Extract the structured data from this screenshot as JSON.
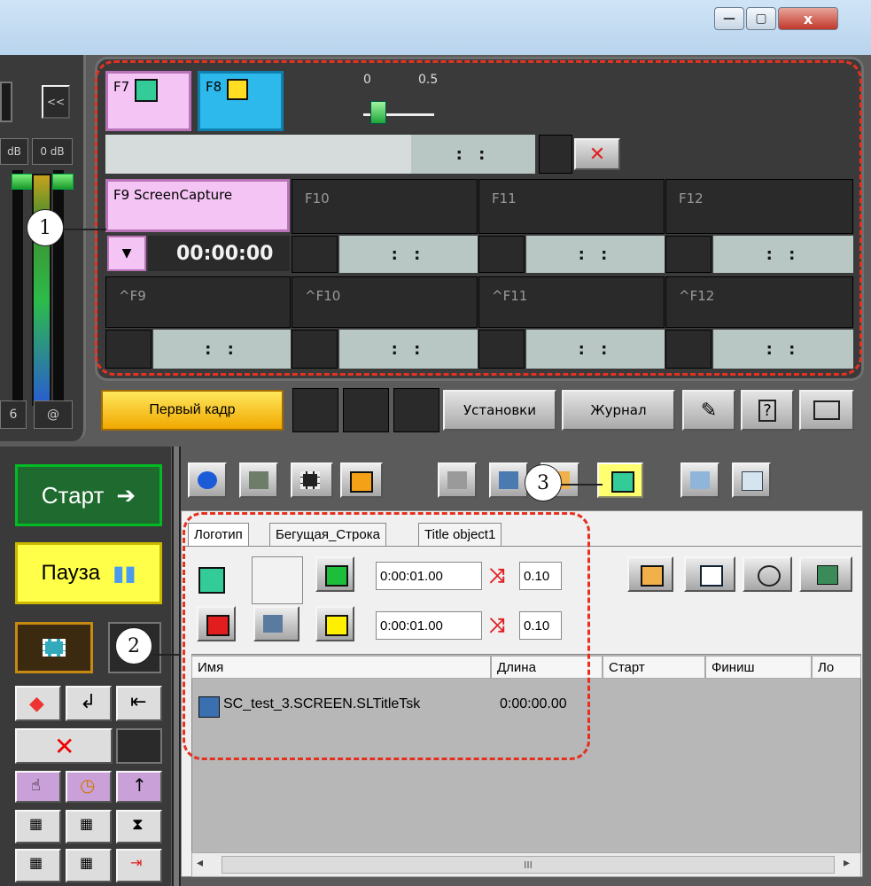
{
  "window": {
    "minimize": "—",
    "maximize": "▢",
    "close": "x"
  },
  "left": {
    "collapse": "<<",
    "db_left": "dB",
    "db_right": "0 dB",
    "num": "6",
    "at": "@"
  },
  "keys": {
    "f7": "F7",
    "f8": "F8",
    "slider_ticks": [
      "0",
      "0.5"
    ],
    "slider_value": 0,
    "top_time": ":  :",
    "f9": "F9  ScreenCapture",
    "f10": "F10",
    "f11": "F11",
    "f12": "F12",
    "timecode": "00:00:00",
    "cell_time": ":   :",
    "cf9": "^F9",
    "cf10": "^F10",
    "cf11": "^F11",
    "cf12": "^F12"
  },
  "buttons": {
    "first_frame": "Первый кадр",
    "settings": "Установки",
    "journal": "Журнал"
  },
  "side": {
    "start": "Старт",
    "start_arrow": "➔",
    "pause": "Пауза",
    "pause_icon": "▮▮"
  },
  "callouts": [
    "1",
    "2",
    "3"
  ],
  "tabs": [
    "Логотип",
    "Бегущая_Строка",
    "Title object1"
  ],
  "fields": {
    "time1": "0:00:01.00",
    "mix1": "0.10",
    "time2": "0:00:01.00",
    "mix2": "0.10"
  },
  "table": {
    "columns": [
      "Имя",
      "Длина",
      "Старт",
      "Финиш",
      "Ло"
    ],
    "rows": [
      {
        "name": "SC_test_3.SCREEN.SLTitleTsk",
        "length": "0:00:00.00"
      }
    ]
  },
  "scroll": {
    "left": "◂",
    "right": "▸",
    "grip": "III"
  },
  "colors": {
    "accent_red": "#e33222",
    "pink": "#f4c4f4",
    "cyan": "#2db9ec",
    "yellow": "#ffd800",
    "green": "#1f6b2f"
  }
}
